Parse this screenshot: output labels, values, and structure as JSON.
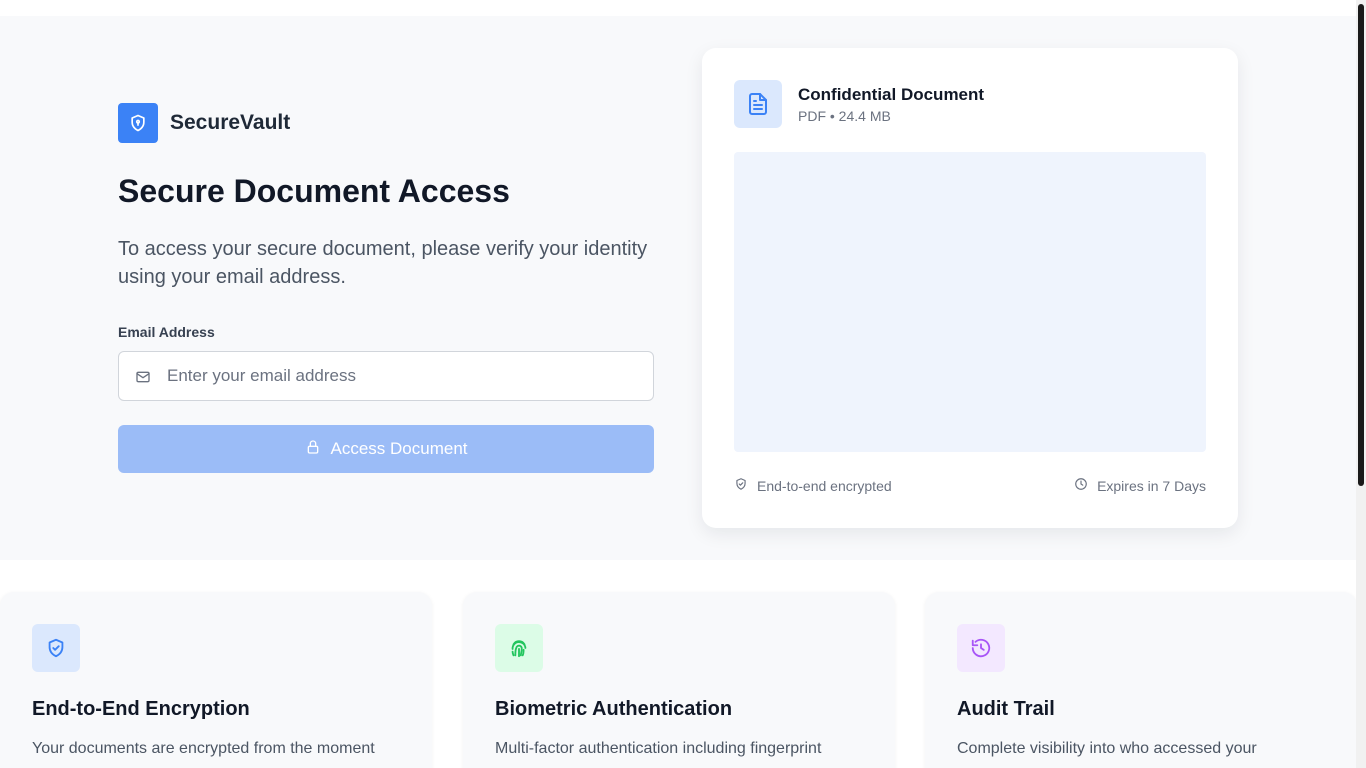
{
  "brand": {
    "name": "SecureVault",
    "logo_icon": "shield-icon",
    "accent": "#3b82f6"
  },
  "hero": {
    "title": "Secure Document Access",
    "subtitle": "To access your secure document, please verify your identity using your email address."
  },
  "form": {
    "email_label": "Email Address",
    "email_placeholder": "Enter your email address",
    "email_value": "",
    "email_icon": "mail-icon",
    "submit_label": "Access Document",
    "submit_icon": "lock-icon",
    "submit_state": "disabled"
  },
  "document": {
    "icon": "file-text-icon",
    "name": "Confidential Document",
    "meta": "PDF • 24.4 MB",
    "encryption_icon": "shield-check-icon",
    "encryption_text": "End-to-end encrypted",
    "expiry_icon": "clock-icon",
    "expiry_text": "Expires in 7 Days"
  },
  "features": [
    {
      "icon": "shield-check-icon",
      "icon_bg": "#dbe8fd",
      "icon_color": "#3b82f6",
      "title": "End-to-End Encryption",
      "description": "Your documents are encrypted from the moment"
    },
    {
      "icon": "fingerprint-icon",
      "icon_bg": "#dcfce7",
      "icon_color": "#22c55e",
      "title": "Biometric Authentication",
      "description": "Multi-factor authentication including fingerprint"
    },
    {
      "icon": "history-icon",
      "icon_bg": "#f3e8ff",
      "icon_color": "#a855f7",
      "title": "Audit Trail",
      "description": "Complete visibility into who accessed your"
    }
  ]
}
